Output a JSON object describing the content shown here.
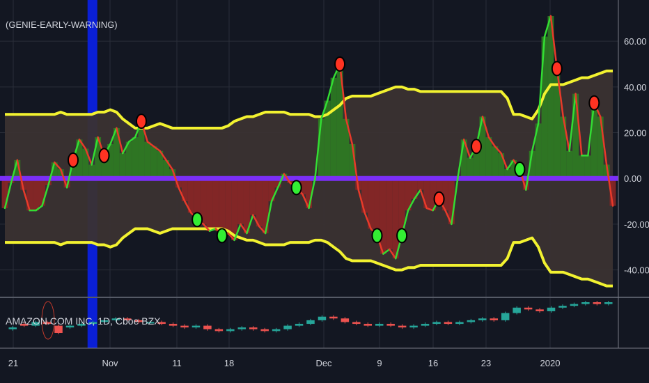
{
  "chart_data": [
    {
      "type": "line",
      "title": "(GENIE-EARLY-WARNING)",
      "xlabel": "",
      "ylabel": "",
      "ylim": [
        -52,
        78
      ],
      "y_ticks": [
        60,
        40,
        20,
        0,
        -20,
        -40
      ],
      "y_tick_labels": [
        "60.00",
        "40.00",
        "20.00",
        "0.00",
        "-20.00",
        "-40.00"
      ],
      "x_tick_labels": [
        "21",
        "Nov",
        "11",
        "18",
        "Dec",
        "9",
        "16",
        "23",
        "2020"
      ],
      "x": [
        0,
        1,
        2,
        3,
        4,
        5,
        6,
        7,
        8,
        9,
        10,
        11,
        12,
        13,
        14,
        15,
        16,
        17,
        18,
        19,
        20,
        21,
        22,
        23,
        24,
        25,
        26,
        27,
        28,
        29,
        30,
        31,
        32,
        33,
        34,
        35,
        36,
        37,
        38,
        39,
        40,
        41,
        42,
        43,
        44,
        45,
        46,
        47,
        48,
        49,
        50,
        51,
        52,
        53,
        54,
        55,
        56,
        57,
        58,
        59,
        60,
        61,
        62,
        63,
        64,
        65,
        66,
        67,
        68,
        69,
        70,
        71,
        72,
        73,
        74,
        75,
        76,
        77,
        78,
        79,
        80,
        81,
        82,
        83,
        84,
        85,
        86,
        87,
        88,
        89,
        90,
        91,
        92,
        93,
        94,
        95,
        96,
        97,
        98
      ],
      "series": [
        {
          "role": "oscillator",
          "color_up": "#33dd33",
          "color_down": "#e83a2a",
          "values": [
            -13,
            -2,
            8,
            -5,
            -14,
            -14,
            -12,
            -3,
            7,
            4,
            -4,
            8,
            17,
            13,
            6,
            18,
            10,
            15,
            22,
            11,
            16,
            18,
            25,
            16,
            14,
            12,
            8,
            4,
            -4,
            -10,
            -15,
            -18,
            -20,
            -23,
            -22,
            -25,
            -24,
            -27,
            -20,
            -24,
            -16,
            -21,
            -24,
            -10,
            -4,
            2,
            -2,
            -4,
            -7,
            -13,
            0,
            26,
            34,
            44,
            50,
            26,
            15,
            -5,
            -15,
            -22,
            -25,
            -33,
            -31,
            -35,
            -25,
            -14,
            -9,
            -5,
            -13,
            -14,
            -9,
            -14,
            -20,
            0,
            17,
            9,
            14,
            27,
            18,
            14,
            11,
            4,
            8,
            4,
            -5,
            12,
            24,
            62,
            71,
            48,
            27,
            12,
            37,
            10,
            10,
            33,
            27,
            6,
            -12
          ]
        },
        {
          "role": "histogram",
          "color_pos": "#2e7d22",
          "color_neg": "#8b2626",
          "values": [
            -13,
            -2,
            8,
            -5,
            -14,
            -14,
            -12,
            -3,
            7,
            4,
            -4,
            8,
            17,
            13,
            6,
            18,
            10,
            15,
            22,
            11,
            16,
            18,
            25,
            16,
            14,
            12,
            8,
            4,
            -4,
            -10,
            -15,
            -18,
            -20,
            -23,
            -22,
            -25,
            -24,
            -27,
            -20,
            -24,
            -16,
            -21,
            -24,
            -10,
            -4,
            2,
            -2,
            -4,
            -7,
            -13,
            0,
            26,
            34,
            44,
            50,
            26,
            15,
            -5,
            -15,
            -22,
            -25,
            -33,
            -31,
            -35,
            -25,
            -14,
            -9,
            -5,
            -13,
            -14,
            -9,
            -14,
            -20,
            0,
            17,
            9,
            14,
            27,
            18,
            14,
            11,
            4,
            8,
            4,
            -5,
            12,
            24,
            62,
            71,
            48,
            27,
            12,
            37,
            10,
            10,
            33,
            27,
            6,
            -12
          ]
        },
        {
          "role": "upper-band",
          "color": "#f2f230",
          "values": [
            28,
            28,
            28,
            28,
            28,
            28,
            28,
            28,
            28,
            29,
            28,
            28,
            28,
            28,
            28,
            29,
            29,
            30,
            29,
            26,
            24,
            22,
            22,
            22,
            23,
            24,
            23,
            22,
            22,
            22,
            22,
            22,
            22,
            22,
            22,
            22,
            23,
            25,
            26,
            27,
            27,
            28,
            29,
            29,
            29,
            29,
            28,
            28,
            28,
            28,
            27,
            27,
            28,
            30,
            32,
            35,
            36,
            36,
            36,
            36,
            37,
            38,
            39,
            40,
            40,
            39,
            39,
            38,
            38,
            38,
            38,
            38,
            38,
            38,
            38,
            38,
            38,
            38,
            38,
            38,
            38,
            35,
            28,
            28,
            27,
            26,
            30,
            37,
            41,
            41,
            41,
            42,
            43,
            44,
            44,
            45,
            46,
            47,
            47
          ]
        },
        {
          "role": "lower-band",
          "color": "#f2f230",
          "values": [
            -28,
            -28,
            -28,
            -28,
            -28,
            -28,
            -28,
            -28,
            -28,
            -29,
            -28,
            -28,
            -28,
            -28,
            -28,
            -29,
            -29,
            -30,
            -29,
            -26,
            -24,
            -22,
            -22,
            -22,
            -23,
            -24,
            -23,
            -22,
            -22,
            -22,
            -22,
            -22,
            -22,
            -22,
            -22,
            -22,
            -23,
            -25,
            -26,
            -27,
            -27,
            -28,
            -29,
            -29,
            -29,
            -29,
            -28,
            -28,
            -28,
            -28,
            -27,
            -27,
            -28,
            -30,
            -32,
            -35,
            -36,
            -36,
            -36,
            -36,
            -37,
            -38,
            -39,
            -40,
            -40,
            -39,
            -39,
            -38,
            -38,
            -38,
            -38,
            -38,
            -38,
            -38,
            -38,
            -38,
            -38,
            -38,
            -38,
            -38,
            -38,
            -35,
            -28,
            -28,
            -27,
            -26,
            -30,
            -37,
            -41,
            -41,
            -41,
            -42,
            -43,
            -44,
            -44,
            -45,
            -46,
            -47,
            -47
          ]
        },
        {
          "role": "zero-line",
          "color": "#7b2ff7",
          "values": [
            0
          ]
        }
      ],
      "signals": {
        "sell": {
          "color": "#ff3322",
          "x": [
            11,
            16,
            22,
            54,
            70,
            76,
            89,
            95
          ]
        },
        "buy": {
          "color": "#33ee33",
          "x": [
            31,
            35,
            47,
            60,
            64,
            83
          ]
        }
      },
      "highlight_band": {
        "color": "#0a1fd6",
        "x": 14
      },
      "band_fill": "#3a3232",
      "grid": true,
      "legend_position": "none"
    },
    {
      "type": "candlestick",
      "title": "AMAZON.COM INC, 1D, Cboe BZX",
      "candles": [
        {
          "o": 0,
          "c": 1
        },
        {
          "o": 3,
          "c": 2
        },
        {
          "o": 2,
          "c": 4
        },
        {
          "o": 4,
          "c": 3
        },
        {
          "o": 2,
          "c": -2
        },
        {
          "o": 1,
          "c": 2
        },
        {
          "o": 2,
          "c": 3
        },
        {
          "o": 3,
          "c": 4
        },
        {
          "o": 4,
          "c": 5
        },
        {
          "o": 5,
          "c": 6
        },
        {
          "o": 6,
          "c": 5
        },
        {
          "o": 5,
          "c": 4
        },
        {
          "o": 4,
          "c": 4
        },
        {
          "o": 4,
          "c": 3
        },
        {
          "o": 3,
          "c": 2
        },
        {
          "o": 2,
          "c": 1
        },
        {
          "o": 1,
          "c": 2
        },
        {
          "o": 2,
          "c": 0
        },
        {
          "o": 0,
          "c": -1
        },
        {
          "o": -1,
          "c": 0
        },
        {
          "o": 0,
          "c": 1
        },
        {
          "o": 1,
          "c": 0
        },
        {
          "o": 0,
          "c": -1
        },
        {
          "o": -1,
          "c": 0
        },
        {
          "o": 0,
          "c": 2
        },
        {
          "o": 2,
          "c": 3
        },
        {
          "o": 3,
          "c": 5
        },
        {
          "o": 5,
          "c": 7
        },
        {
          "o": 7,
          "c": 6
        },
        {
          "o": 6,
          "c": 4
        },
        {
          "o": 4,
          "c": 3
        },
        {
          "o": 3,
          "c": 2
        },
        {
          "o": 2,
          "c": 3
        },
        {
          "o": 3,
          "c": 2
        },
        {
          "o": 2,
          "c": 1
        },
        {
          "o": 1,
          "c": 2
        },
        {
          "o": 2,
          "c": 3
        },
        {
          "o": 3,
          "c": 4
        },
        {
          "o": 4,
          "c": 3
        },
        {
          "o": 3,
          "c": 4
        },
        {
          "o": 4,
          "c": 5
        },
        {
          "o": 5,
          "c": 6
        },
        {
          "o": 6,
          "c": 5
        },
        {
          "o": 5,
          "c": 9
        },
        {
          "o": 9,
          "c": 12
        },
        {
          "o": 12,
          "c": 11
        },
        {
          "o": 11,
          "c": 10
        },
        {
          "o": 10,
          "c": 12
        },
        {
          "o": 12,
          "c": 13
        },
        {
          "o": 13,
          "c": 14
        },
        {
          "o": 14,
          "c": 15
        },
        {
          "o": 15,
          "c": 14
        },
        {
          "o": 14,
          "c": 15
        }
      ]
    }
  ]
}
